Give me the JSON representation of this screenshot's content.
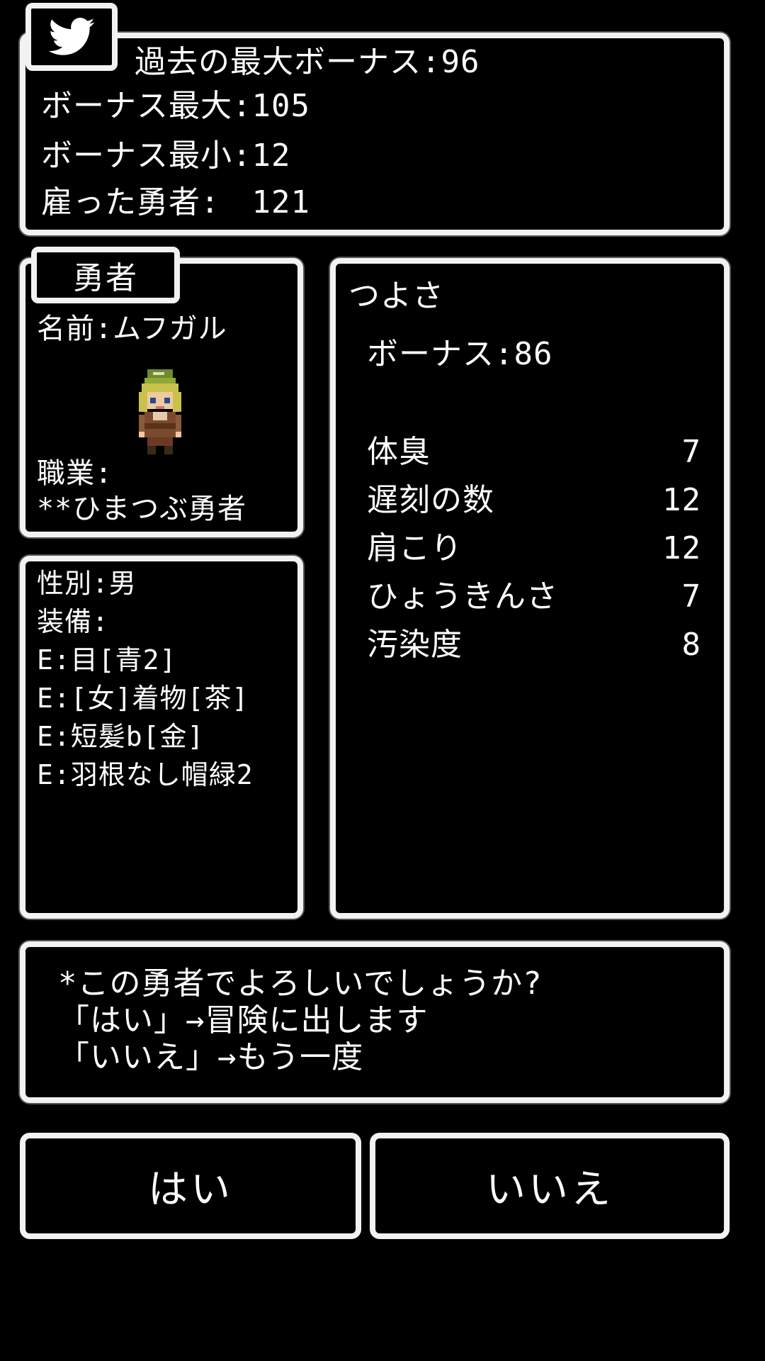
{
  "summary": {
    "past_max_bonus": "過去の最大ボーナス:96",
    "bonus_max": "ボーナス最大:105",
    "bonus_min": "ボーナス最小:12",
    "hired_heroes": "雇った勇者:　121"
  },
  "hero": {
    "tab_label": "勇者",
    "name": "名前:ムフガル",
    "job_label": "職業:",
    "job_value": "**ひまつぶ勇者"
  },
  "equipment": {
    "gender": "性別:男",
    "equip_label": "装備:",
    "items": [
      "E:目[青2]",
      "E:[女]着物[茶]",
      "E:短髪b[金]",
      "E:羽根なし帽緑2"
    ]
  },
  "stats": {
    "title": "つよさ",
    "bonus": "ボーナス:86",
    "rows": [
      {
        "label": "体臭",
        "value": "7"
      },
      {
        "label": "遅刻の数",
        "value": "12"
      },
      {
        "label": "肩こり",
        "value": "12"
      },
      {
        "label": "ひょうきんさ",
        "value": "7"
      },
      {
        "label": "汚染度",
        "value": "8"
      }
    ]
  },
  "message": {
    "line1": "*この勇者でよろしいでしょうか?",
    "line2": "「はい」→冒険に出します",
    "line3": "「いいえ」→もう一度"
  },
  "buttons": {
    "yes": "はい",
    "no": "いいえ"
  },
  "icons": {
    "twitter": "twitter-bird-icon",
    "hero_sprite": "hero-sprite"
  },
  "colors": {
    "background": "#000000",
    "border": "#f2f2f2",
    "text": "#ffffff"
  }
}
